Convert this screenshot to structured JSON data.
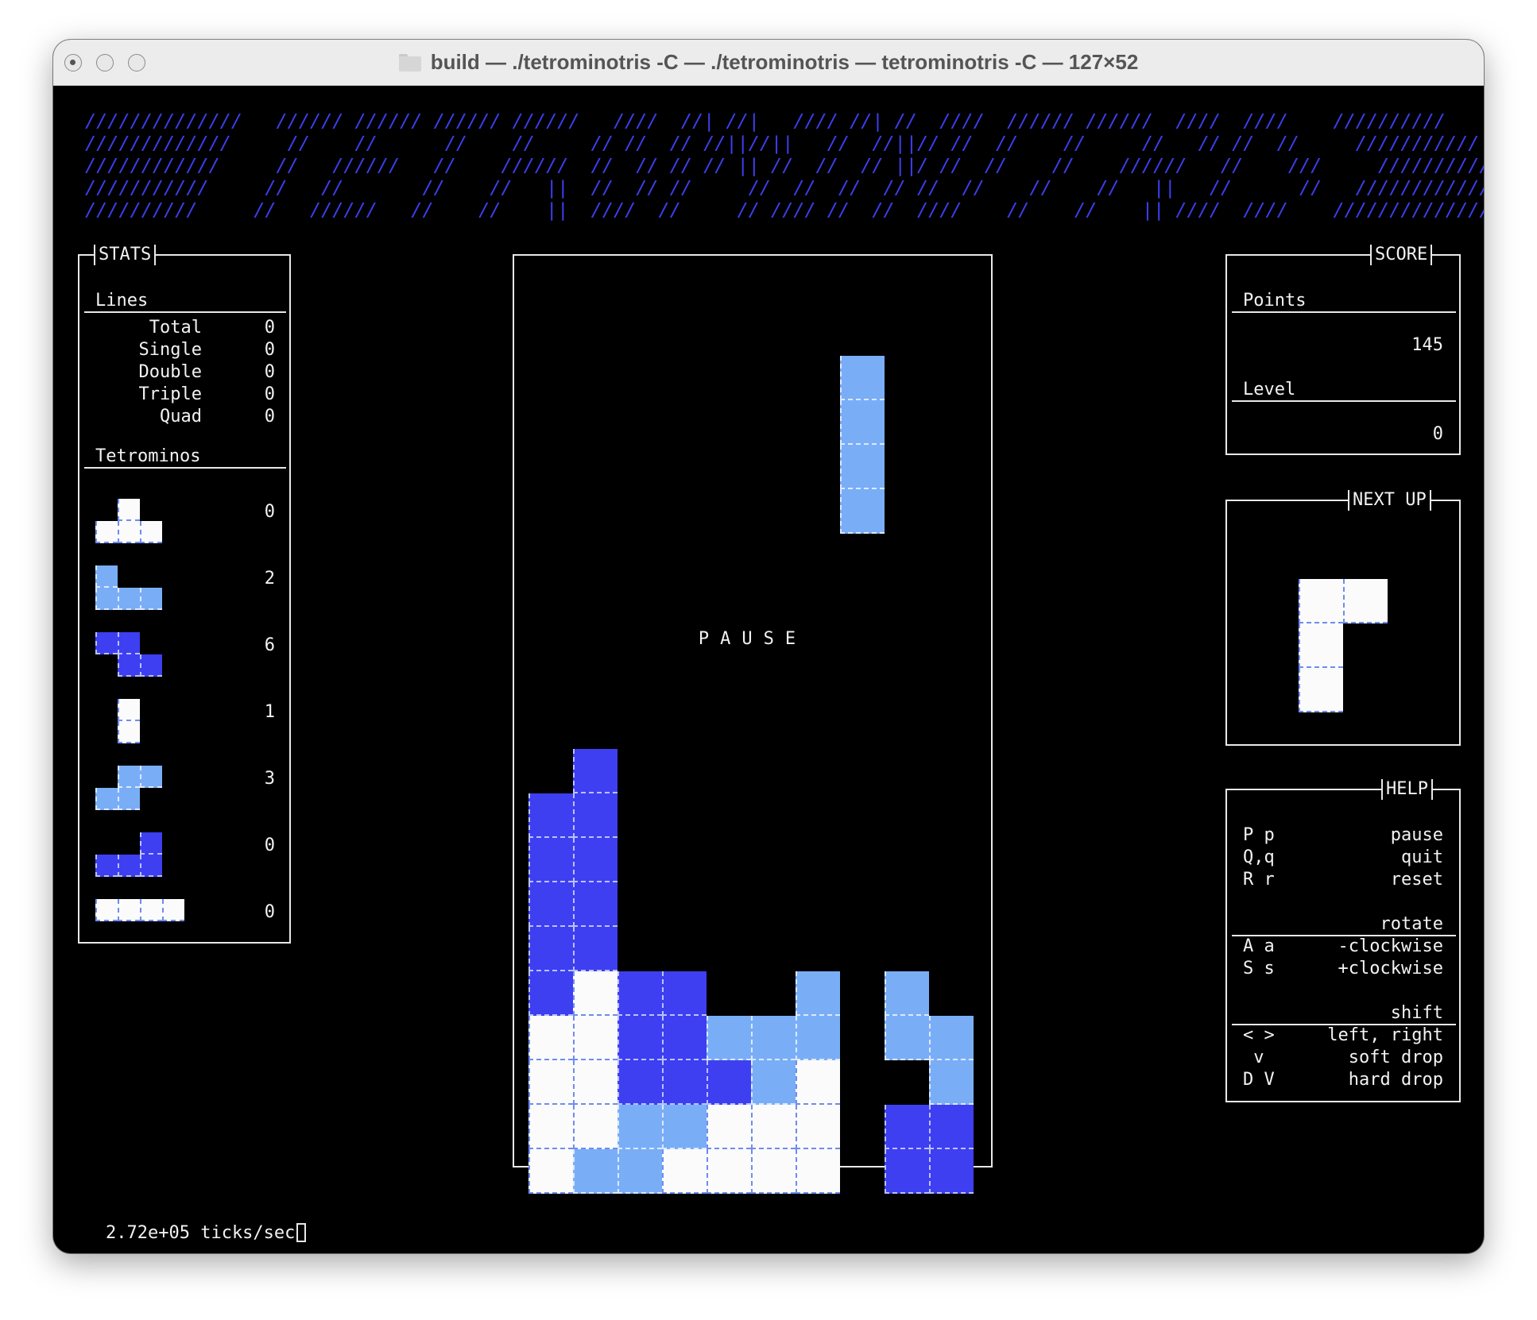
{
  "window": {
    "title": "build — ./tetrominotris -C — ./tetrominotris — tetrominotris -C — 127×52"
  },
  "banner": {
    "lines": [
      "//////////////   ////// ////// ////// //////   ////  //| //|   //// //| //  ////  ////// //////  ////  ////    //////////",
      "/////////////     //    //      //    //     // //  // //||//||   //  //||// //  //    //     //   // //  //     ///////////",
      "////////////     //   //////   //    //////  //  // // // || //  //  // ||/ //  //    //    //////   //    ///     ////////////",
      "///////////     //   //       //    //   ||  //  // //     //  //  //  // //  //    //    //   ||   //      //   /////////////",
      "//////////     //   //////   //    //    ||  ////  //     // //// //  //  ////    //    //    || ////  ////    //////////////"
    ]
  },
  "stats": {
    "title": "STATS",
    "lines_header": "Lines",
    "lines": [
      {
        "label": "Total",
        "value": "0"
      },
      {
        "label": "Single",
        "value": "0"
      },
      {
        "label": "Double",
        "value": "0"
      },
      {
        "label": "Triple",
        "value": "0"
      },
      {
        "label": "Quad",
        "value": "0"
      }
    ],
    "tetrominos_header": "Tetrominos",
    "tetromino_counts": [
      "0",
      "2",
      "6",
      "1",
      "3",
      "0",
      "0"
    ]
  },
  "board": {
    "pause_text": "PAUSE"
  },
  "score": {
    "title": "SCORE",
    "points_label": "Points",
    "points_value": "145",
    "level_label": "Level",
    "level_value": "0"
  },
  "next_up": {
    "title": "NEXT UP"
  },
  "help": {
    "title": "HELP",
    "rows_general": [
      {
        "key": "P p",
        "action": "pause"
      },
      {
        "key": "Q,q",
        "action": "quit"
      },
      {
        "key": "R r",
        "action": "reset"
      }
    ],
    "rotate_header": "rotate",
    "rows_rotate": [
      {
        "key": "A a",
        "action": "-clockwise"
      },
      {
        "key": "S s",
        "action": "+clockwise"
      }
    ],
    "shift_header": "shift",
    "rows_shift": [
      {
        "key": "< >",
        "action": "left, right"
      },
      {
        "key": " v",
        "action": "soft drop"
      },
      {
        "key": "D V",
        "action": "hard drop"
      }
    ]
  },
  "status_bar": {
    "text": "2.72e+05 ticks/sec"
  },
  "colors": {
    "background": "#000000",
    "banner_blue": "#3d3ff0",
    "piece_white": "#fbfbfb",
    "piece_light_blue": "#79aef7",
    "piece_dark_blue": "#3e3ff0"
  },
  "tetrominos": {
    "stats_pieces": [
      {
        "color": "w",
        "cells": [
          [
            1,
            0
          ],
          [
            0,
            1
          ],
          [
            1,
            1
          ],
          [
            2,
            1
          ]
        ]
      },
      {
        "color": "l",
        "cells": [
          [
            0,
            0
          ],
          [
            0,
            1
          ],
          [
            1,
            1
          ],
          [
            2,
            1
          ]
        ]
      },
      {
        "color": "d",
        "cells": [
          [
            0,
            0
          ],
          [
            1,
            0
          ],
          [
            1,
            1
          ],
          [
            2,
            1
          ]
        ]
      },
      {
        "color": "w",
        "cells": [
          [
            1,
            0
          ],
          [
            1,
            1
          ]
        ]
      },
      {
        "color": "l",
        "cells": [
          [
            1,
            0
          ],
          [
            2,
            0
          ],
          [
            0,
            1
          ],
          [
            1,
            1
          ]
        ]
      },
      {
        "color": "d",
        "cells": [
          [
            2,
            0
          ],
          [
            0,
            1
          ],
          [
            1,
            1
          ],
          [
            2,
            1
          ]
        ]
      },
      {
        "color": "w",
        "cells": [
          [
            0,
            0
          ],
          [
            1,
            0
          ],
          [
            2,
            0
          ],
          [
            3,
            0
          ]
        ]
      }
    ],
    "falling_piece": {
      "color": "l",
      "cells": [
        [
          7,
          0
        ],
        [
          7,
          1
        ],
        [
          7,
          2
        ],
        [
          7,
          3
        ]
      ]
    },
    "board_stack": [
      "...........",
      "...........",
      "...........",
      "...........",
      "...........",
      "...........",
      "...........",
      "...........",
      "...........",
      ".d.........",
      "dd.........",
      "dd.........",
      "dd.........",
      "dd.........",
      "dwdd..l.l..",
      "wwddlll.ll.",
      "wwdddlw..l.",
      "wwllwww.dd.",
      "wllwwww.dd."
    ],
    "next_piece": {
      "color": "w",
      "cells": [
        [
          0,
          0
        ],
        [
          1,
          0
        ],
        [
          0,
          1
        ],
        [
          0,
          2
        ]
      ]
    }
  }
}
